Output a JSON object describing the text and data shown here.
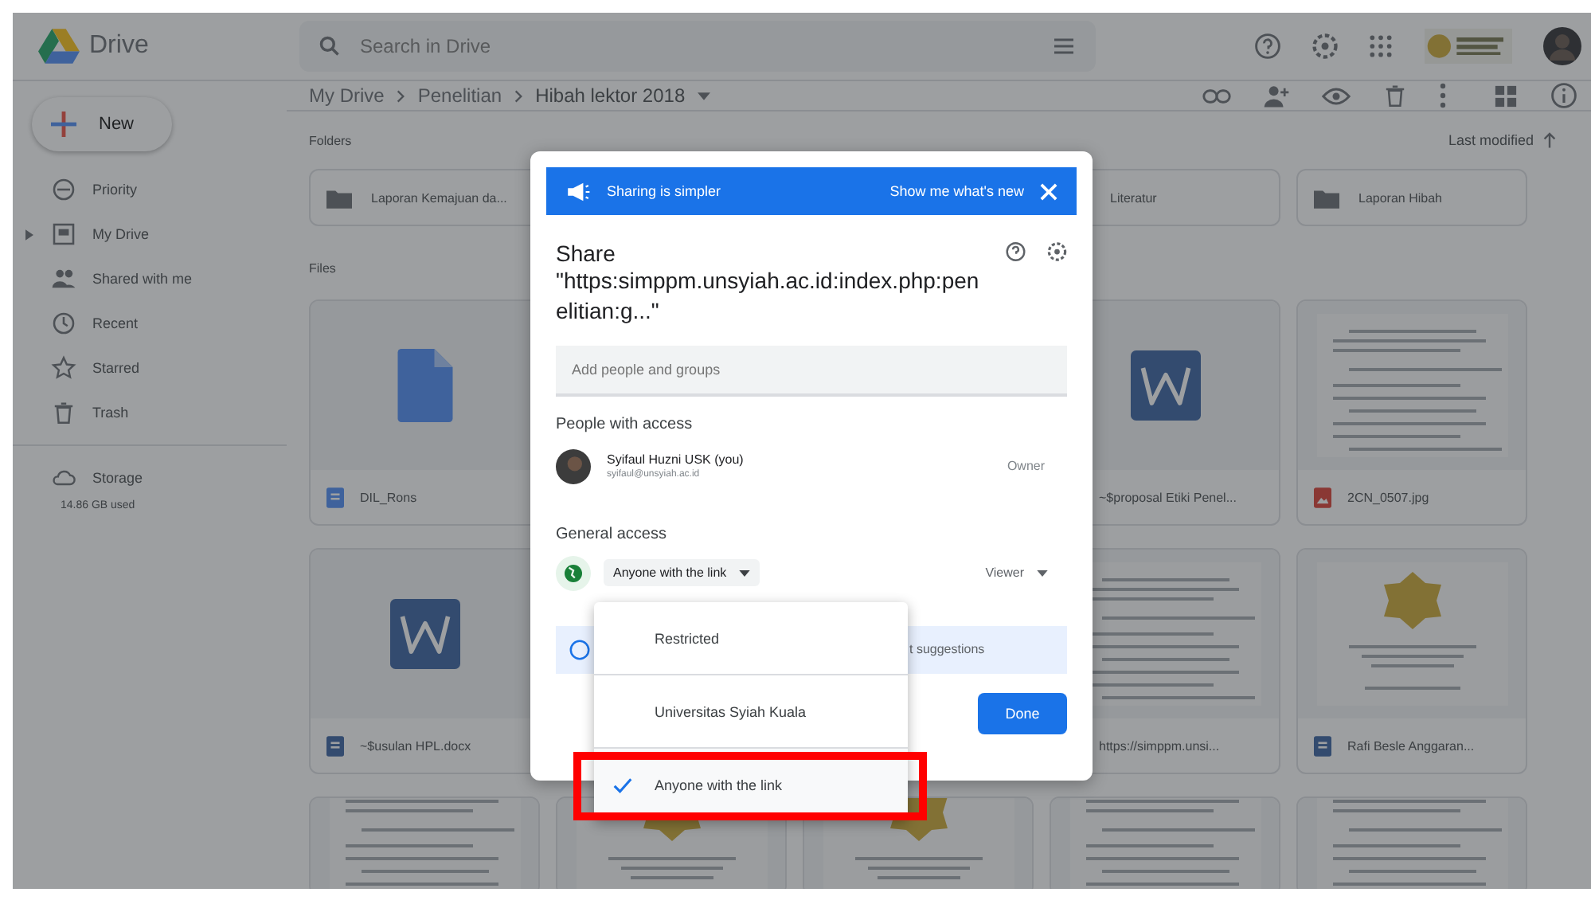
{
  "app": {
    "name": "Drive"
  },
  "search": {
    "placeholder": "Search in Drive"
  },
  "new_button": "New",
  "sidebar": {
    "items": [
      {
        "label": "Priority",
        "kind": "priority",
        "expandable": false
      },
      {
        "label": "My Drive",
        "kind": "drive",
        "expandable": true
      },
      {
        "label": "Shared with me",
        "kind": "people",
        "expandable": false
      },
      {
        "label": "Recent",
        "kind": "clock",
        "expandable": false
      },
      {
        "label": "Starred",
        "kind": "star",
        "expandable": false
      },
      {
        "label": "Trash",
        "kind": "trash",
        "expandable": false
      }
    ],
    "storage": {
      "label": "Storage",
      "usage": "14.86 GB used"
    }
  },
  "breadcrumb": [
    "My Drive",
    "Penelitian",
    "Hibah lektor 2018"
  ],
  "folders": {
    "heading": "Folders",
    "sort": "Last modified",
    "cells": [
      {
        "name": "Laporan Kemajuan da..."
      },
      null,
      null,
      {
        "name": "Literatur"
      },
      {
        "name": "Laporan Hibah"
      }
    ]
  },
  "files": {
    "heading": "Files",
    "rows": [
      {
        "cells": [
          {
            "kind": "docs",
            "name": "DIL_Rons"
          },
          null,
          null,
          {
            "kind": "word",
            "name": "~$proposal Etiki Penel..."
          },
          {
            "kind": "image",
            "name": "2CN_0507.jpg"
          }
        ]
      },
      {
        "cells": [
          {
            "kind": "word",
            "name": "~$usulan HPL.docx"
          },
          null,
          null,
          {
            "kind": "pdf",
            "name": "https://simppm.unsi..."
          },
          {
            "kind": "emblem",
            "name": "Rafi Besle Anggaran..."
          }
        ]
      },
      {
        "cells": [
          {
            "kind": "page"
          },
          {
            "kind": "emblem-page"
          },
          {
            "kind": "emblem-page"
          },
          {
            "kind": "page"
          },
          {
            "kind": "page"
          }
        ]
      }
    ]
  },
  "share_dialog": {
    "banner": {
      "text": "Sharing is simpler",
      "link": "Show me what's new"
    },
    "heading": "Share",
    "title": "\"https:simppm.unsyiah.ac.id:index.php:penelitian:g...\"",
    "add_field": {
      "placeholder": "Add people and groups"
    },
    "people_heading": "People with access",
    "people": [
      {
        "name": "Syifaul Huzni USK (you)",
        "email": "syifaul@unsyiah.ac.id",
        "role": "Owner"
      }
    ],
    "general_heading": "General access",
    "access": {
      "value": "Anyone with the link",
      "role": "Viewer"
    },
    "info_text": "t suggestions",
    "done": "Done"
  },
  "access_menu": [
    {
      "label": "Restricted",
      "selected": false
    },
    {
      "label": "Universitas Syiah Kuala",
      "selected": false
    },
    {
      "label": "Anyone with the link",
      "selected": true
    }
  ],
  "annotation": {
    "kind": "highlight",
    "color": "#ff0000"
  }
}
